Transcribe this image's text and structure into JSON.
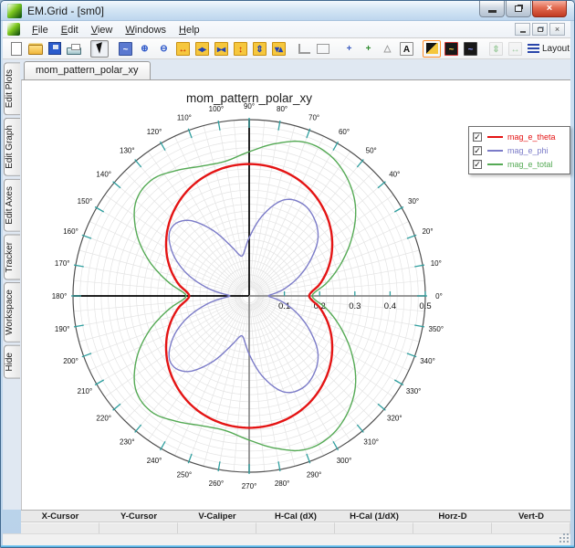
{
  "window": {
    "title": "EM.Grid - [sm0]"
  },
  "menu": {
    "items": [
      {
        "label": "File",
        "accel_index": 0
      },
      {
        "label": "Edit",
        "accel_index": 0
      },
      {
        "label": "View",
        "accel_index": 0
      },
      {
        "label": "Windows",
        "accel_index": 0
      },
      {
        "label": "Help",
        "accel_index": 0
      }
    ]
  },
  "toolbar": {
    "layout_label": "Layout",
    "items": [
      {
        "name": "new-document-icon",
        "kind": "page"
      },
      {
        "name": "open-icon",
        "kind": "folder"
      },
      {
        "name": "save-icon",
        "kind": "floppy"
      },
      {
        "name": "print-icon",
        "kind": "printer"
      },
      {
        "kind": "sep"
      },
      {
        "name": "pointer-tool-icon",
        "kind": "pointer",
        "pressed": true
      },
      {
        "kind": "sep"
      },
      {
        "name": "zoom-box-icon",
        "kind": "glyph",
        "glyph": "~",
        "fg": "#ffffff",
        "bg": "#5b79d0",
        "border": "#35509a"
      },
      {
        "name": "zoom-in-icon",
        "kind": "glyph",
        "glyph": "⊕",
        "fg": "#2b56c8",
        "bg": "",
        "border": ""
      },
      {
        "name": "zoom-out-icon",
        "kind": "glyph",
        "glyph": "⊖",
        "fg": "#2b56c8",
        "bg": "",
        "border": ""
      },
      {
        "name": "expand-x-icon",
        "kind": "glyph",
        "glyph": "↔",
        "fg": "#cc2200",
        "bg": "#f6c73d",
        "border": "#c89010"
      },
      {
        "name": "pan-x-icon",
        "kind": "glyph",
        "glyph": "◂▸",
        "fg": "#2343b4",
        "bg": "#f6c73d",
        "border": "#c89010"
      },
      {
        "name": "compress-x-icon",
        "kind": "glyph",
        "glyph": "▸◂",
        "fg": "#2343b4",
        "bg": "#f6c73d",
        "border": "#c89010"
      },
      {
        "name": "expand-y-icon",
        "kind": "glyph",
        "glyph": "↕",
        "fg": "#cc2200",
        "bg": "#f6c73d",
        "border": "#c89010"
      },
      {
        "name": "pan-y-icon",
        "kind": "glyph",
        "glyph": "⇕",
        "fg": "#2343b4",
        "bg": "#f6c73d",
        "border": "#c89010"
      },
      {
        "name": "compress-y-icon",
        "kind": "glyph",
        "glyph": "▾▴",
        "fg": "#2343b4",
        "bg": "#f6c73d",
        "border": "#c89010"
      },
      {
        "kind": "sep"
      },
      {
        "name": "corner-grid-icon",
        "kind": "corner"
      },
      {
        "name": "frame-grid-icon",
        "kind": "frame"
      },
      {
        "kind": "sep"
      },
      {
        "name": "crosshair-icon",
        "kind": "glyph",
        "glyph": "+",
        "fg": "#3b5bc0",
        "bg": "",
        "border": ""
      },
      {
        "name": "axes-tool-icon",
        "kind": "glyph",
        "glyph": "+",
        "fg": "#2e8b2e",
        "bg": "",
        "border": ""
      },
      {
        "name": "marker-triangle-icon",
        "kind": "glyph",
        "glyph": "△",
        "fg": "#9a9a9a",
        "bg": "",
        "border": ""
      },
      {
        "name": "text-annotation-icon",
        "kind": "glyph",
        "glyph": "A",
        "fg": "#111111",
        "bg": "#f8f8f8",
        "border": "#8a8a8a"
      },
      {
        "kind": "sep"
      },
      {
        "name": "colormap-icon",
        "kind": "colormap"
      },
      {
        "name": "curve-style-yellow-icon",
        "kind": "glyph",
        "glyph": "~",
        "fg": "#ffd24a",
        "bg": "#181818",
        "border": "#cc3333"
      },
      {
        "name": "curve-style-blue-icon",
        "kind": "glyph",
        "glyph": "~",
        "fg": "#8893ff",
        "bg": "#181818",
        "border": "#4a4a4a"
      },
      {
        "kind": "sep"
      },
      {
        "name": "tile-vertical-icon",
        "kind": "glyph",
        "glyph": "⇕",
        "fg": "#3a9a3a",
        "bg": "#eeeeee",
        "border": "#bbbbbb",
        "disabled": true
      },
      {
        "name": "tile-horizontal-icon",
        "kind": "glyph",
        "glyph": "↔",
        "fg": "#3a9a3a",
        "bg": "#eeeeee",
        "border": "#bbbbbb",
        "disabled": true
      },
      {
        "name": "layout-button",
        "kind": "layout"
      }
    ]
  },
  "sidebar": {
    "tabs": [
      "Edit Plots",
      "Edit Graph",
      "Edit Axes",
      "Tracker",
      "Workspace",
      "Hide"
    ]
  },
  "tab": {
    "label": "mom_pattern_polar_xy"
  },
  "readout": {
    "columns": [
      "X-Cursor",
      "Y-Cursor",
      "V-Caliper",
      "H-Cal (dX)",
      "H-Cal (1/dX)",
      "Horz-D",
      "Vert-D"
    ],
    "values": [
      "",
      "",
      "",
      "",
      "",
      "",
      ""
    ]
  },
  "chart_data": {
    "type": "polar",
    "title": "mom_pattern_polar_xy",
    "r_axis": {
      "min": 0,
      "max": 0.5,
      "tick_step": 0.1,
      "tick_labels": [
        "0.1",
        "0.2",
        "0.3",
        "0.4",
        "0.5"
      ]
    },
    "angle_ticks_deg": [
      0,
      10,
      20,
      30,
      40,
      50,
      60,
      70,
      80,
      90,
      100,
      110,
      120,
      130,
      140,
      150,
      160,
      170,
      180,
      190,
      200,
      210,
      220,
      230,
      240,
      250,
      260,
      270,
      280,
      290,
      300,
      310,
      320,
      330,
      340,
      350
    ],
    "angle_label_suffix": "°",
    "grid": {
      "r_step": 0.02,
      "angle_step_deg": 5,
      "tick_color": "#2f9f9f"
    },
    "legend_position": "top-right",
    "sample_step_deg": 10,
    "series": [
      {
        "name": "mag_e_theta",
        "color": "#e41414",
        "checked": true,
        "r": [
          0.17,
          0.205,
          0.24,
          0.272,
          0.301,
          0.326,
          0.347,
          0.362,
          0.371,
          0.374,
          0.371,
          0.362,
          0.347,
          0.326,
          0.301,
          0.272,
          0.24,
          0.205,
          0.17,
          0.205,
          0.24,
          0.272,
          0.301,
          0.326,
          0.347,
          0.362,
          0.371,
          0.374,
          0.371,
          0.362,
          0.347,
          0.326,
          0.301,
          0.272,
          0.24,
          0.205
        ]
      },
      {
        "name": "mag_e_phi",
        "color": "#7b7bc8",
        "checked": true,
        "r": [
          0.055,
          0.095,
          0.145,
          0.2,
          0.255,
          0.287,
          0.302,
          0.29,
          0.235,
          0.165,
          0.115,
          0.15,
          0.22,
          0.28,
          0.292,
          0.253,
          0.19,
          0.115,
          0.055,
          0.115,
          0.19,
          0.253,
          0.292,
          0.28,
          0.22,
          0.15,
          0.115,
          0.165,
          0.235,
          0.29,
          0.302,
          0.287,
          0.255,
          0.2,
          0.145,
          0.095
        ]
      },
      {
        "name": "mag_e_total",
        "color": "#55aa55",
        "checked": true,
        "r": [
          0.179,
          0.226,
          0.28,
          0.338,
          0.394,
          0.434,
          0.46,
          0.464,
          0.439,
          0.409,
          0.388,
          0.392,
          0.411,
          0.43,
          0.419,
          0.371,
          0.306,
          0.235,
          0.179,
          0.235,
          0.306,
          0.371,
          0.419,
          0.43,
          0.411,
          0.392,
          0.388,
          0.409,
          0.439,
          0.464,
          0.46,
          0.434,
          0.394,
          0.338,
          0.28,
          0.226
        ]
      }
    ]
  }
}
